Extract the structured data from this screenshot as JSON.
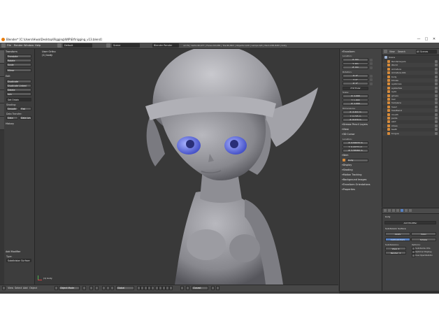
{
  "window": {
    "title": "Blender* [C:\\Users\\Hiwa\\Desktop\\Rigging\\WIP\\Elf\\rigging_v13.blend]",
    "min": "—",
    "max": "□",
    "close": "✕"
  },
  "menubar": {
    "menus": [
      "File",
      "Render",
      "Window",
      "Help"
    ],
    "layout": "Default",
    "scene": "Scene",
    "engine": "Blender Render",
    "stats": "v2.79 | Verts:40,977 | Faces:40,436 | Tris:80,863 | Objects:1/29 | Lamps:0/0 | Mem:265.82M | body"
  },
  "toolshelf": {
    "transform_header": "Transform",
    "transform_buttons": [
      "Translate",
      "Rotate",
      "Scale",
      "Mirror"
    ],
    "edit_header": "Edit",
    "edit_buttons": [
      "Duplicate",
      "Duplicate Linked",
      "Delete",
      "Join"
    ],
    "set_origin": "Set Origin",
    "shading_label": "Shading:",
    "shading_buttons": [
      "Smooth",
      "Flat"
    ],
    "data_transfer_label": "Data Transfer:",
    "data_buttons": [
      "Data",
      "Data Layout"
    ],
    "history_header": "History",
    "add_modifier_header": "Add Modifier",
    "type_label": "Type:",
    "type_value": "Subdivision Surface"
  },
  "viewport": {
    "view_name": "User Ortho",
    "object_name": "(1) body",
    "corner_label": "(1) body"
  },
  "viewbar": {
    "view": "View",
    "select": "Select",
    "add": "Add",
    "object": "Object",
    "mode": "Object Mode",
    "pivot": "Global",
    "snap": "Closest"
  },
  "properties": {
    "transform_header": "Transform",
    "location_label": "Location:",
    "location": [
      "X: 0m",
      "Y: 0m",
      "Z: 0m"
    ],
    "rotation_label": "Rotation:",
    "rotation": [
      "X: 0°",
      "Y: 0°",
      "Z: 0°"
    ],
    "mode": "XYZ Euler",
    "scale_label": "Scale:",
    "scale": [
      "X: 1.000",
      "Y: 1.000",
      "Z: 1.000"
    ],
    "dimensions_label": "Dimensions:",
    "dimensions": [
      "X: 2.411 m",
      "Y: 0.725 m",
      "Z: 8.079 m"
    ],
    "grease_pencil": "Grease Pencil Layers",
    "view_header": "View",
    "cursor_header": "3D Cursor",
    "cursor_location_label": "Location:",
    "cursor_location": [
      "X: 0.94272 m",
      "Y: 0.43771 m",
      "Z: 5.58469 m"
    ],
    "item_header": "Item",
    "item_name": "body",
    "display_header": "Display",
    "shading_header": "Shading",
    "motion_tracking": "Motion Tracking",
    "background_images": "Background Images",
    "transform_orientations": "Transform Orientations",
    "properties_header": "Properties"
  },
  "outliner": {
    "header_view": "View",
    "header_search": "Search",
    "header_scenes": "All Scenes",
    "root": "Scene",
    "items": [
      "RenderLayers",
      "World",
      "Armature",
      "Armature.001",
      "body",
      "blouse",
      "eyebrows",
      "eyelashes",
      "eyes",
      "gloves",
      "hair",
      "hairpiece",
      "head",
      "headband",
      "mouth",
      "pants",
      "skirt",
      "shoes",
      "teeth",
      "tongue"
    ]
  },
  "rprops": {
    "add_modifier": "Add Modifier",
    "subsurf": "Subdivision Surface",
    "catmull": "Catmull-Clark",
    "simple": "Simple",
    "subdivisions_label": "Subdivisions:",
    "options_label": "Options:",
    "view_label": "View:",
    "view_val": "2",
    "render_label": "Render:",
    "render_val": "2",
    "opt_uv": "Subdivide UVs",
    "opt_optimal": "Optimal Display",
    "opt_cage": "Use OpenSubdiv",
    "apply": "Apply",
    "copy": "Copy"
  }
}
